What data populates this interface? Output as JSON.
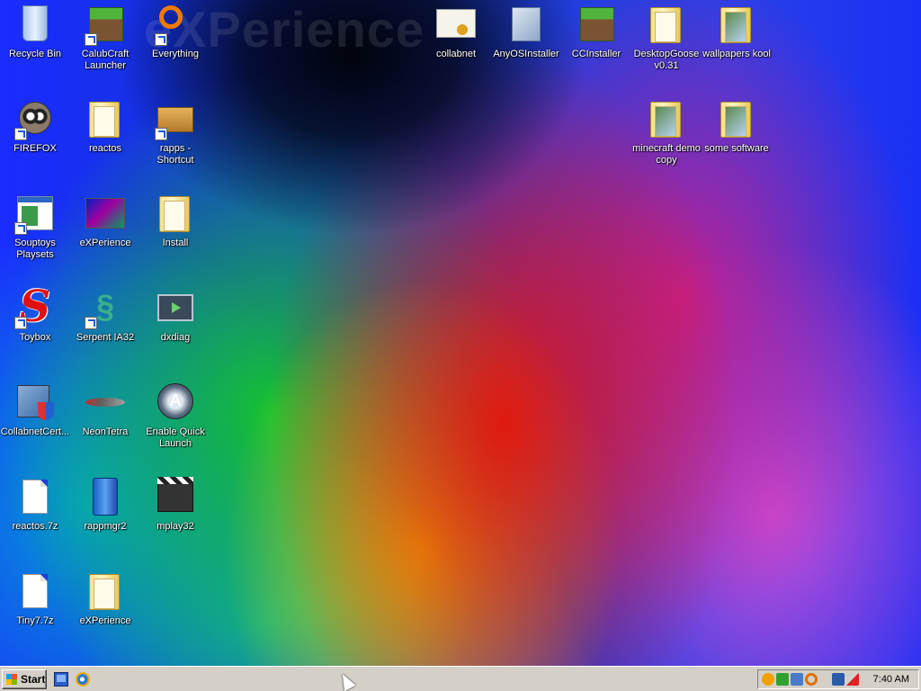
{
  "desktop": {
    "watermark": "eXPerience",
    "icons": [
      {
        "label": "Recycle Bin",
        "icon": "recycle-bin-icon"
      },
      {
        "label": "CalubCraft Launcher",
        "icon": "grass-block-icon"
      },
      {
        "label": "Everything",
        "icon": "everything-search-icon"
      },
      {
        "label": "FIREFOX",
        "icon": "raccoon-icon"
      },
      {
        "label": "reactos",
        "icon": "folder-icon"
      },
      {
        "label": "rapps - Shortcut",
        "icon": "package-box-icon"
      },
      {
        "label": "Souptoys Playsets",
        "icon": "application-window-icon"
      },
      {
        "label": "eXPerience",
        "icon": "wallpaper-thumbnail-icon"
      },
      {
        "label": "Install",
        "icon": "folder-icon"
      },
      {
        "label": "Toybox",
        "icon": "red-s-logo-icon"
      },
      {
        "label": "Serpent IA32",
        "icon": "serpent-icon"
      },
      {
        "label": "dxdiag",
        "icon": "dxdiag-monitor-icon"
      },
      {
        "label": "CollabnetCert...",
        "icon": "computer-shield-icon"
      },
      {
        "label": "NeonTetra",
        "icon": "neon-tetra-fish-icon"
      },
      {
        "label": "Enable Quick Launch",
        "icon": "aqua-launcher-icon"
      },
      {
        "label": "reactos.7z",
        "icon": "blank-document-icon"
      },
      {
        "label": "rappmgr2",
        "icon": "blue-cabinet-icon"
      },
      {
        "label": "mplay32",
        "icon": "clapperboard-icon"
      },
      {
        "label": "Tiny7.7z",
        "icon": "blank-document-icon"
      },
      {
        "label": "eXPerience",
        "icon": "folder-icon"
      },
      {
        "label": "collabnet",
        "icon": "certificate-icon"
      },
      {
        "label": "AnyOSInstaller",
        "icon": "installer-icon"
      },
      {
        "label": "CCInstaller",
        "icon": "grass-block-icon"
      },
      {
        "label": "DesktopGoose v0.31",
        "icon": "folder-icon"
      },
      {
        "label": "wallpapers kool",
        "icon": "picture-folder-icon"
      },
      {
        "label": "minecraft demo copy",
        "icon": "picture-folder-icon"
      },
      {
        "label": "some software",
        "icon": "picture-folder-icon"
      }
    ]
  },
  "taskbar": {
    "start_label": "Start",
    "quick_launch": [
      "show-desktop-icon",
      "internet-explorer-icon"
    ],
    "tray_icons": [
      "shield-alert-icon",
      "security-check-icon",
      "network-icon",
      "search-tray-icon",
      "network-monitors-icon",
      "volume-muted-icon"
    ],
    "clock": "7:40 AM"
  }
}
